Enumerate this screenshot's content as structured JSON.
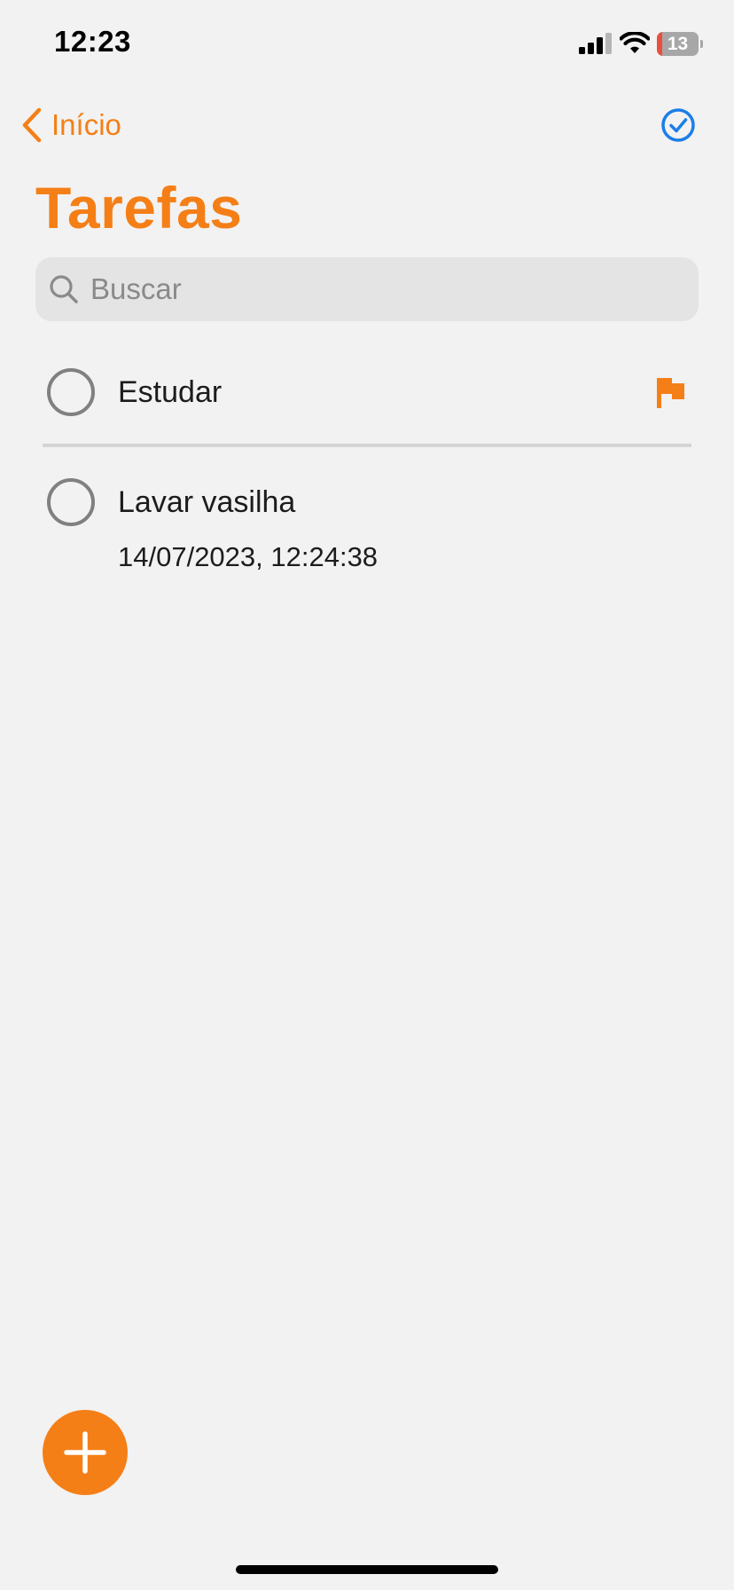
{
  "status_bar": {
    "time": "12:23",
    "battery_level": 13,
    "battery_label": "13"
  },
  "nav": {
    "back_label": "Início"
  },
  "page": {
    "title": "Tarefas"
  },
  "search": {
    "placeholder": "Buscar",
    "value": ""
  },
  "tasks": [
    {
      "title": "Estudar",
      "date": "",
      "flagged": true,
      "completed": false
    },
    {
      "title": "Lavar vasilha",
      "date": "14/07/2023, 12:24:38",
      "flagged": false,
      "completed": false
    }
  ],
  "colors": {
    "accent": "#f57f17",
    "done_icon": "#1a7ee8",
    "background": "#f2f2f2",
    "battery_low": "#eb4e3d"
  },
  "icons": {
    "back": "chevron-left-icon",
    "done": "checkmark-circle-icon",
    "search": "magnifying-glass-icon",
    "flag": "flag-icon",
    "add": "plus-icon"
  }
}
